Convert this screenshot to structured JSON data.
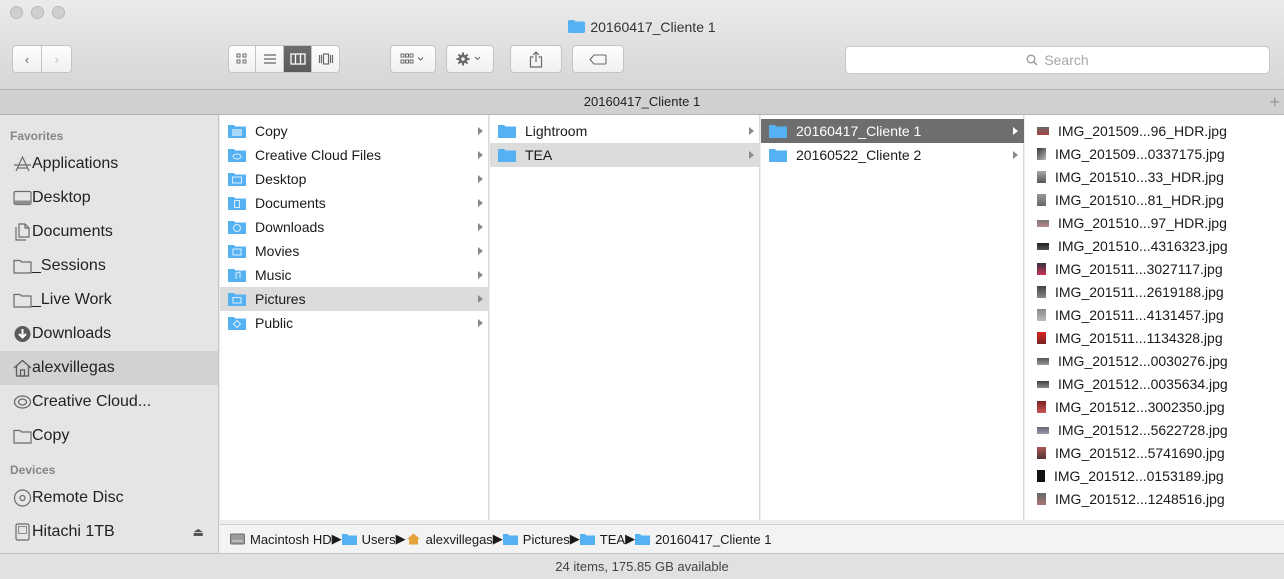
{
  "window": {
    "title": "20160417_Cliente 1"
  },
  "toolbar": {
    "back_icon": "chevron-left-icon",
    "forward_icon": "chevron-right-icon",
    "search_placeholder": "Search"
  },
  "tab": {
    "title": "20160417_Cliente 1",
    "add_label": "+"
  },
  "sidebar": {
    "favorites_header": "Favorites",
    "favorites": [
      {
        "label": "Applications",
        "icon": "applications-icon"
      },
      {
        "label": "Desktop",
        "icon": "desktop-icon"
      },
      {
        "label": "Documents",
        "icon": "documents-icon"
      },
      {
        "label": "_Sessions",
        "icon": "folder-icon"
      },
      {
        "label": "_Live Work",
        "icon": "folder-icon"
      },
      {
        "label": "Downloads",
        "icon": "downloads-icon"
      },
      {
        "label": "alexvillegas",
        "icon": "home-icon",
        "selected": true
      },
      {
        "label": "Creative Cloud...",
        "icon": "creative-cloud-icon"
      },
      {
        "label": "Copy",
        "icon": "folder-icon"
      }
    ],
    "devices_header": "Devices",
    "devices": [
      {
        "label": "Remote Disc",
        "icon": "disc-icon"
      },
      {
        "label": "Hitachi 1TB",
        "icon": "external-drive-icon",
        "eject": "⏏"
      }
    ]
  },
  "column1": [
    {
      "label": "Copy"
    },
    {
      "label": "Creative Cloud Files"
    },
    {
      "label": "Desktop"
    },
    {
      "label": "Documents"
    },
    {
      "label": "Downloads"
    },
    {
      "label": "Movies"
    },
    {
      "label": "Music"
    },
    {
      "label": "Pictures",
      "selected": true
    },
    {
      "label": "Public"
    }
  ],
  "column2": [
    {
      "label": "Lightroom"
    },
    {
      "label": "TEA",
      "selected": true
    }
  ],
  "column3": [
    {
      "label": "20160417_Cliente 1",
      "selected": true
    },
    {
      "label": "20160522_Cliente 2"
    }
  ],
  "column4": [
    "IMG_201509...96_HDR.jpg",
    "IMG_201509...0337175.jpg",
    "IMG_201510...33_HDR.jpg",
    "IMG_201510...81_HDR.jpg",
    "IMG_201510...97_HDR.jpg",
    "IMG_201510...4316323.jpg",
    "IMG_201511...3027117.jpg",
    "IMG_201511...2619188.jpg",
    "IMG_201511...4131457.jpg",
    "IMG_201511...1134328.jpg",
    "IMG_201512...0030276.jpg",
    "IMG_201512...0035634.jpg",
    "IMG_201512...3002350.jpg",
    "IMG_201512...5622728.jpg",
    "IMG_201512...5741690.jpg",
    "IMG_201512...0153189.jpg",
    "IMG_201512...1248516.jpg"
  ],
  "pathbar": [
    "Macintosh HD",
    "Users",
    "alexvillegas",
    "Pictures",
    "TEA",
    "20160417_Cliente 1"
  ],
  "status": "24 items, 175.85 GB available",
  "colors": {
    "folder_blue": "#56b1f2",
    "selection_gray": "#6e6e6e"
  }
}
